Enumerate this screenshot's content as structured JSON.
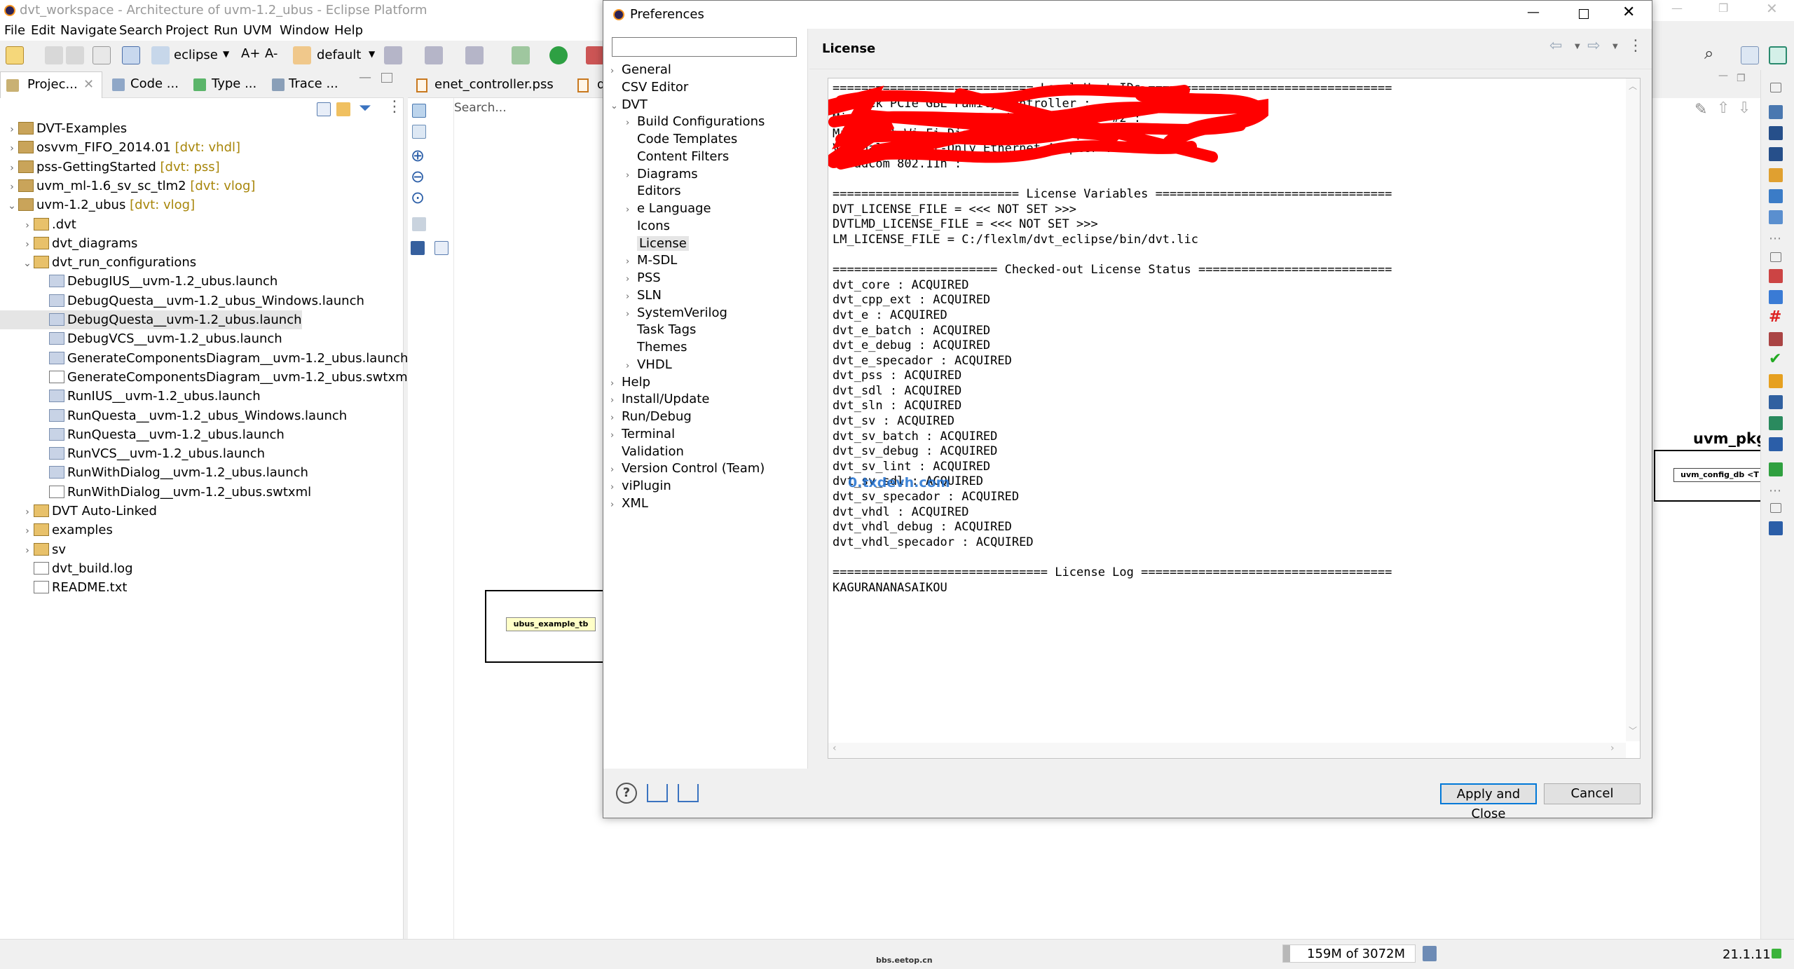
{
  "window": {
    "title": "dvt_workspace - Architecture of uvm-1.2_ubus - Eclipse Platform"
  },
  "menubar": [
    "File",
    "Edit",
    "Navigate",
    "Search",
    "Project",
    "Run",
    "UVM",
    "Window",
    "Help"
  ],
  "toolbar": {
    "project_combo": "eclipse",
    "perspective_combo": "default"
  },
  "left_tabs": [
    "Projec...",
    "Code ...",
    "Type ...",
    "Trace ..."
  ],
  "editor_tabs": [
    "enet_controller.pss",
    "d"
  ],
  "project_tree": [
    {
      "label": "DVT-Examples",
      "dec": "",
      "level": 0,
      "arrow": "›",
      "kind": "project"
    },
    {
      "label": "osvvm_FIFO_2014.01",
      "dec": " [dvt: vhdl]",
      "level": 0,
      "arrow": "›",
      "kind": "project"
    },
    {
      "label": "pss-GettingStarted",
      "dec": " [dvt: pss]",
      "level": 0,
      "arrow": "›",
      "kind": "project"
    },
    {
      "label": "uvm_ml-1.6_sv_sc_tlm2",
      "dec": " [dvt: vlog]",
      "level": 0,
      "arrow": "›",
      "kind": "project"
    },
    {
      "label": "uvm-1.2_ubus",
      "dec": " [dvt: vlog]",
      "level": 0,
      "arrow": "⌄",
      "kind": "project"
    },
    {
      "label": ".dvt",
      "dec": "",
      "level": 1,
      "arrow": "›",
      "kind": "folder"
    },
    {
      "label": "dvt_diagrams",
      "dec": "",
      "level": 1,
      "arrow": "›",
      "kind": "folder"
    },
    {
      "label": "dvt_run_configurations",
      "dec": "",
      "level": 1,
      "arrow": "⌄",
      "kind": "folder"
    },
    {
      "label": "DebugIUS__uvm-1.2_ubus.launch",
      "dec": "",
      "level": 2,
      "arrow": "",
      "kind": "file"
    },
    {
      "label": "DebugQuesta__uvm-1.2_ubus_Windows.launch",
      "dec": "",
      "level": 2,
      "arrow": "",
      "kind": "file"
    },
    {
      "label": "DebugQuesta__uvm-1.2_ubus.launch",
      "dec": "",
      "level": 2,
      "arrow": "",
      "kind": "file",
      "selected": true
    },
    {
      "label": "DebugVCS__uvm-1.2_ubus.launch",
      "dec": "",
      "level": 2,
      "arrow": "",
      "kind": "file"
    },
    {
      "label": "GenerateComponentsDiagram__uvm-1.2_ubus.launch",
      "dec": "",
      "level": 2,
      "arrow": "",
      "kind": "file"
    },
    {
      "label": "GenerateComponentsDiagram__uvm-1.2_ubus.swtxml",
      "dec": "",
      "level": 2,
      "arrow": "",
      "kind": "xml"
    },
    {
      "label": "RunIUS__uvm-1.2_ubus.launch",
      "dec": "",
      "level": 2,
      "arrow": "",
      "kind": "file"
    },
    {
      "label": "RunQuesta__uvm-1.2_ubus_Windows.launch",
      "dec": "",
      "level": 2,
      "arrow": "",
      "kind": "file"
    },
    {
      "label": "RunQuesta__uvm-1.2_ubus.launch",
      "dec": "",
      "level": 2,
      "arrow": "",
      "kind": "file"
    },
    {
      "label": "RunVCS__uvm-1.2_ubus.launch",
      "dec": "",
      "level": 2,
      "arrow": "",
      "kind": "file"
    },
    {
      "label": "RunWithDialog__uvm-1.2_ubus.launch",
      "dec": "",
      "level": 2,
      "arrow": "",
      "kind": "file"
    },
    {
      "label": "RunWithDialog__uvm-1.2_ubus.swtxml",
      "dec": "",
      "level": 2,
      "arrow": "",
      "kind": "xml"
    },
    {
      "label": "DVT Auto-Linked",
      "dec": "",
      "level": 1,
      "arrow": "›",
      "kind": "folder"
    },
    {
      "label": "examples",
      "dec": "",
      "level": 1,
      "arrow": "›",
      "kind": "folder"
    },
    {
      "label": "sv",
      "dec": "",
      "level": 1,
      "arrow": "›",
      "kind": "folder"
    },
    {
      "label": "dvt_build.log",
      "dec": "",
      "level": 1,
      "arrow": "",
      "kind": "doc"
    },
    {
      "label": "README.txt",
      "dec": "",
      "level": 1,
      "arrow": "",
      "kind": "doc"
    }
  ],
  "diagram": {
    "search_placeholder": "Search...",
    "node_left": "ubus_example_tb",
    "pkg_title": "uvm_pkg",
    "node_right": "uvm_config_db <T"
  },
  "dialog": {
    "title": "Preferences",
    "page_title": "License",
    "filter_value": "",
    "tree": [
      {
        "label": "General",
        "level": 0,
        "arrow": "›"
      },
      {
        "label": "CSV Editor",
        "level": 0,
        "arrow": ""
      },
      {
        "label": "DVT",
        "level": 0,
        "arrow": "⌄"
      },
      {
        "label": "Build Configurations",
        "level": 1,
        "arrow": "›"
      },
      {
        "label": "Code Templates",
        "level": 1,
        "arrow": ""
      },
      {
        "label": "Content Filters",
        "level": 1,
        "arrow": ""
      },
      {
        "label": "Diagrams",
        "level": 1,
        "arrow": "›"
      },
      {
        "label": "Editors",
        "level": 1,
        "arrow": ""
      },
      {
        "label": "e Language",
        "level": 1,
        "arrow": "›"
      },
      {
        "label": "Icons",
        "level": 1,
        "arrow": ""
      },
      {
        "label": "License",
        "level": 1,
        "arrow": "",
        "selected": true
      },
      {
        "label": "M-SDL",
        "level": 1,
        "arrow": "›"
      },
      {
        "label": "PSS",
        "level": 1,
        "arrow": "›"
      },
      {
        "label": "SLN",
        "level": 1,
        "arrow": "›"
      },
      {
        "label": "SystemVerilog",
        "level": 1,
        "arrow": "›"
      },
      {
        "label": "Task Tags",
        "level": 1,
        "arrow": ""
      },
      {
        "label": "Themes",
        "level": 1,
        "arrow": ""
      },
      {
        "label": "VHDL",
        "level": 1,
        "arrow": "›"
      },
      {
        "label": "Help",
        "level": 0,
        "arrow": "›"
      },
      {
        "label": "Install/Update",
        "level": 0,
        "arrow": "›"
      },
      {
        "label": "Run/Debug",
        "level": 0,
        "arrow": "›"
      },
      {
        "label": "Terminal",
        "level": 0,
        "arrow": "›"
      },
      {
        "label": "Validation",
        "level": 0,
        "arrow": ""
      },
      {
        "label": "Version Control (Team)",
        "level": 0,
        "arrow": "›"
      },
      {
        "label": "viPlugin",
        "level": 0,
        "arrow": "›"
      },
      {
        "label": "XML",
        "level": 0,
        "arrow": "›"
      }
    ],
    "license_lines": [
      "============================ Local Host IDs ==================================",
      "Realtek PCIe GBE Family Controller :",
      "Microsoft Wi-Fi Direct Virtual Adapter #2 :",
      "Microsoft Wi-Fi Direct Virtual Adapter :",
      "VirtualBox Host-Only Ethernet Adapter :",
      "Broadcom 802.11n :",
      "",
      "========================== License Variables =================================",
      "DVT_LICENSE_FILE = <<< NOT SET >>>",
      "DVTLMD_LICENSE_FILE = <<< NOT SET >>>",
      "LM_LICENSE_FILE = C:/flexlm/dvt_eclipse/bin/dvt.lic",
      "",
      "======================= Checked-out License Status ===========================",
      "dvt_core : ACQUIRED",
      "dvt_cpp_ext : ACQUIRED",
      "dvt_e : ACQUIRED",
      "dvt_e_batch : ACQUIRED",
      "dvt_e_debug : ACQUIRED",
      "dvt_e_specador : ACQUIRED",
      "dvt_pss : ACQUIRED",
      "dvt_sdl : ACQUIRED",
      "dvt_sln : ACQUIRED",
      "dvt_sv : ACQUIRED",
      "dvt_sv_batch : ACQUIRED",
      "dvt_sv_debug : ACQUIRED",
      "dvt_sv_lint : ACQUIRED",
      "dvt_sv_sdl : ACQUIRED",
      "dvt_sv_specador : ACQUIRED",
      "dvt_vhdl : ACQUIRED",
      "dvt_vhdl_debug : ACQUIRED",
      "dvt_vhdl_specador : ACQUIRED",
      "",
      "============================== License Log ===================================",
      "KAGURANANASAIKOU"
    ],
    "watermark": "0.txdevh.com",
    "apply_label": "Apply and Close",
    "cancel_label": "Cancel"
  },
  "status": {
    "heap": "159M of 3072M",
    "version": "21.1.11",
    "footer_url": "bbs.eetop.cn"
  },
  "colors": {
    "accent": "#0078d7",
    "selection": "#cce8ff",
    "redaction": "#ff0000"
  }
}
